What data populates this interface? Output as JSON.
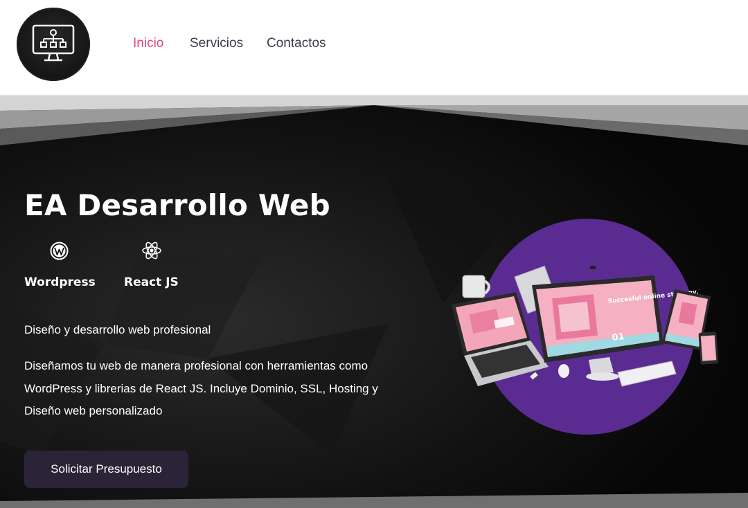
{
  "header": {
    "logo_icon": "computer-sitemap-icon",
    "nav": [
      {
        "label": "Inicio",
        "active": true
      },
      {
        "label": "Servicios",
        "active": false
      },
      {
        "label": "Contactos",
        "active": false
      }
    ],
    "active_color": "#e0457b"
  },
  "hero": {
    "title": "EA Desarrollo Web",
    "tech": [
      {
        "label": "Wordpress",
        "icon": "wordpress-icon"
      },
      {
        "label": "React JS",
        "icon": "react-icon"
      }
    ],
    "subtitle": "Diseño y desarrollo web profesional",
    "description": "Diseñamos tu web de manera profesional con herramientas como WordPress y librerias de React JS. Incluye Dominio, SSL, Hosting y Diseño web personalizado",
    "cta_label": "Solicitar Presupuesto",
    "illustration": {
      "screen_heading": "Succesful online strategy.",
      "screen_number": "01",
      "circle_color": "#5a2c91"
    }
  }
}
